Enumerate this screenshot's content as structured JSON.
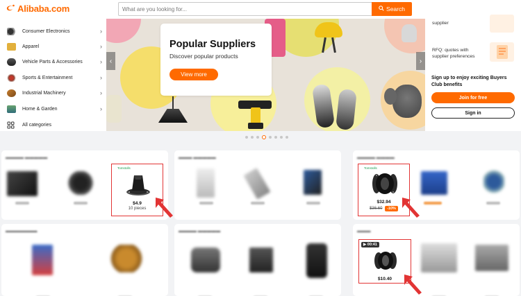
{
  "header": {
    "logo_text": "Alibaba.com",
    "search_placeholder": "What are you looking for...",
    "search_label": "Search",
    "colors": {
      "brand": "#ff6a00"
    }
  },
  "categories": [
    {
      "label": "Consumer Electronics",
      "icon": "headphones-icon"
    },
    {
      "label": "Apparel",
      "icon": "shirt-icon"
    },
    {
      "label": "Vehicle Parts & Accessories",
      "icon": "car-icon"
    },
    {
      "label": "Sports & Entertainment",
      "icon": "sports-icon"
    },
    {
      "label": "Industrial Machinery",
      "icon": "machinery-icon"
    },
    {
      "label": "Home & Garden",
      "icon": "home-garden-icon"
    },
    {
      "label": "All categories",
      "icon": "grid-icon"
    }
  ],
  "banner": {
    "title": "Popular Suppliers",
    "subtitle": "Discover popular products",
    "button_label": "View more"
  },
  "right_panel": {
    "item1": "supplier",
    "item2_line1": "RFQ: quotes with",
    "item2_line2": "supplier preferences",
    "title_line1": "Sign up to enjoy exciting Buyers",
    "title_line2": "Club benefits",
    "join_label": "Join for free",
    "signin_label": "Sign in"
  },
  "carousel": {
    "count": 8,
    "active_index": 3
  },
  "cards": {
    "c1": {
      "highlight": {
        "tag": "Tomstolls",
        "price": "$4.9",
        "qty": "10 pieces"
      }
    },
    "c3": {
      "highlight": {
        "tag": "Tomstolls",
        "price": "$32.94",
        "old_price": "$36.60",
        "discount": "-10%"
      }
    },
    "c6": {
      "highlight": {
        "badge": "00:41",
        "price": "$10.40"
      }
    }
  }
}
